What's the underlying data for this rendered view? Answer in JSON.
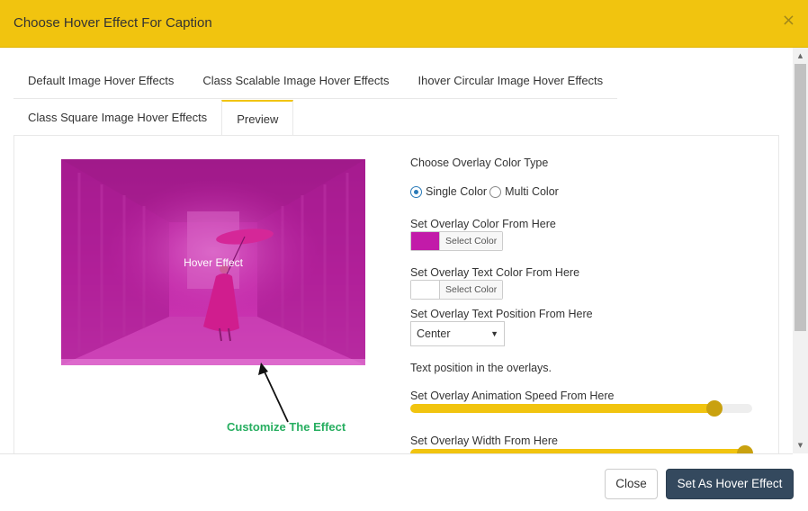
{
  "modal": {
    "title": "Choose Hover Effect For Caption",
    "close_glyph": "×"
  },
  "tabs": [
    {
      "label": "Default Image Hover Effects",
      "active": false
    },
    {
      "label": "Class Scalable Image Hover Effects",
      "active": false
    },
    {
      "label": "Ihover Circular Image Hover Effects",
      "active": false
    },
    {
      "label": "Class Square Image Hover Effects",
      "active": false
    },
    {
      "label": "Preview",
      "active": true
    }
  ],
  "preview": {
    "overlay_text": "Hover Effect",
    "annotation": "Customize The Effect"
  },
  "settings": {
    "overlay_color_type_label": "Choose Overlay Color Type",
    "radio_single": "Single Color",
    "radio_multi": "Multi Color",
    "overlay_color_label": "Set Overlay Color From Here",
    "select_color": "Select Color",
    "overlay_text_color_label": "Set Overlay Text Color From Here",
    "text_position_label": "Set Overlay Text Position From Here",
    "text_position_value": "Center",
    "text_position_help": "Text position in the overlays.",
    "animation_speed_label": "Set Overlay Animation Speed From Here",
    "animation_speed_fraction": 0.89,
    "overlay_width_label": "Set Overlay Width From Here",
    "overlay_width_fraction": 0.98
  },
  "colors": {
    "accent": "#f1c40f",
    "overlay_color": "#c21ba9",
    "overlay_text_color": "#ffffff",
    "primary_button": "#34495e"
  },
  "footer": {
    "close_label": "Close",
    "set_label": "Set As Hover Effect"
  }
}
